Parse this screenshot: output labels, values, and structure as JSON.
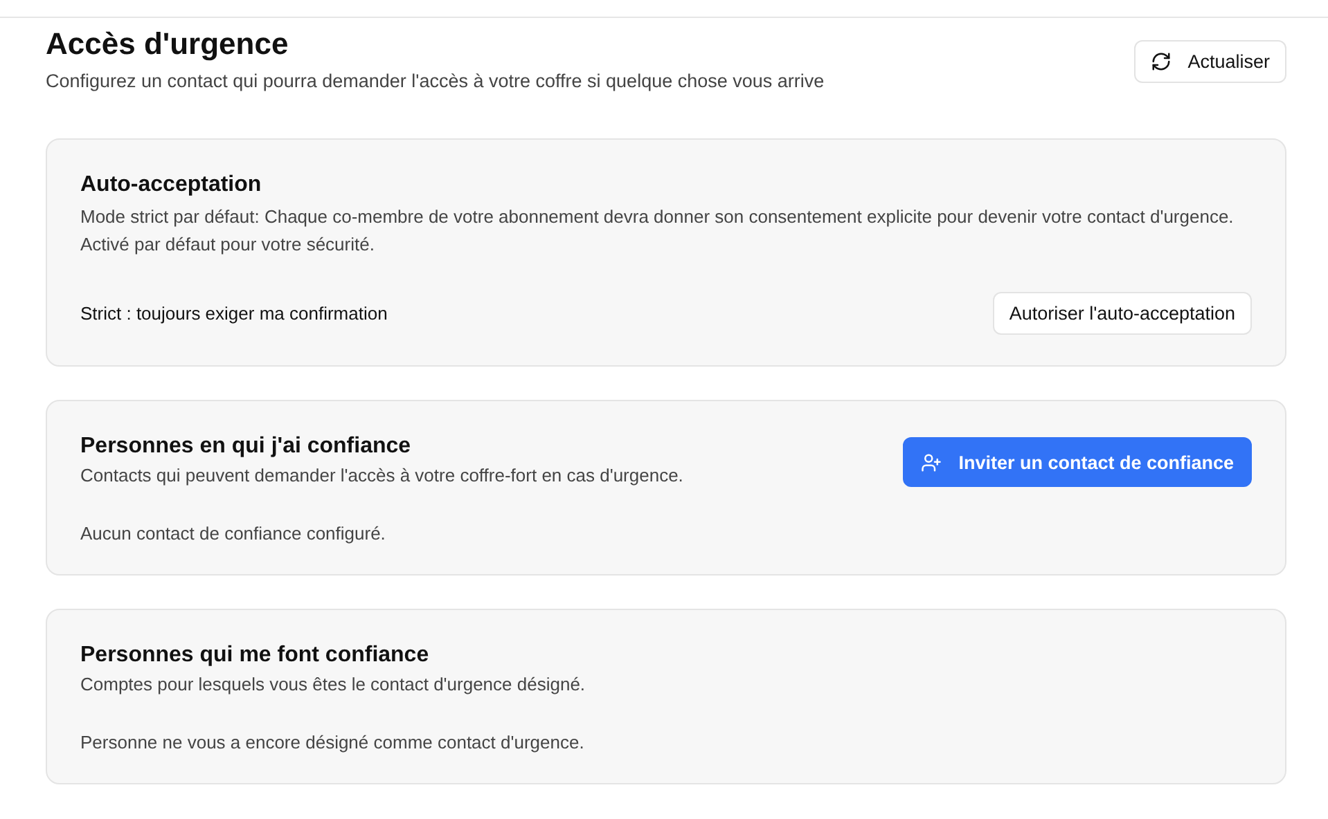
{
  "header": {
    "title": "Accès d'urgence",
    "subtitle": "Configurez un contact qui pourra demander l'accès à votre coffre si quelque chose vous arrive",
    "refresh_button": "Actualiser"
  },
  "sections": [
    {
      "kind": "setting",
      "title": "Auto-acceptation",
      "description": "Mode strict par défaut: Chaque co-membre de votre abonnement devra donner son consentement explicite pour devenir votre contact d'urgence. Activé par défaut pour votre sécurité.",
      "status": "Strict : toujours exiger ma confirmation",
      "button": "Autoriser l'auto-acceptation"
    },
    {
      "kind": "list",
      "title": "Personnes en qui j'ai confiance",
      "description": "Contacts qui peuvent demander l'accès à votre coffre-fort en cas d'urgence.",
      "button": "Inviter un contact de confiance",
      "empty": "Aucun contact de confiance configuré."
    },
    {
      "kind": "list",
      "title": "Personnes qui me font confiance",
      "description": "Comptes pour lesquels vous êtes le contact d'urgence désigné.",
      "empty": "Personne ne vous a encore désigné comme contact d'urgence."
    }
  ]
}
